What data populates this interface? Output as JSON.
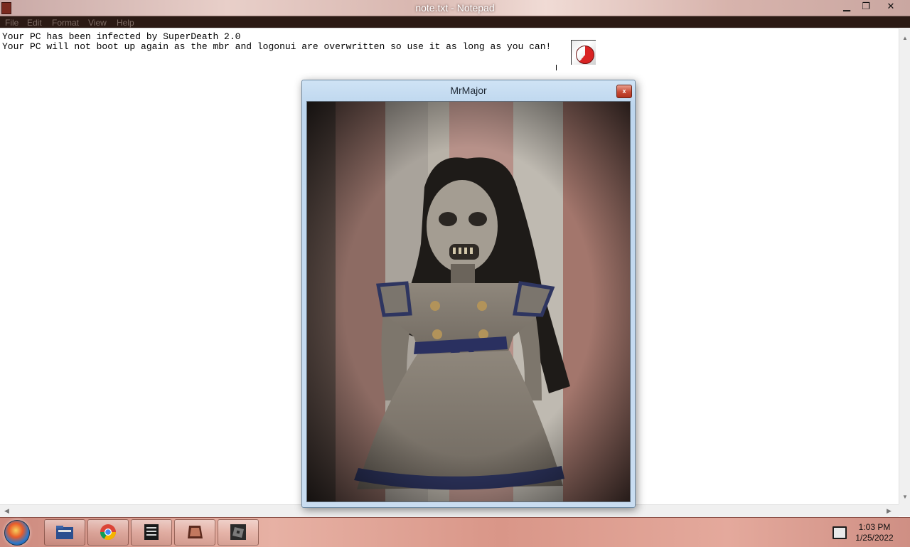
{
  "window": {
    "title": "note.txt - Notepad",
    "controls": {
      "minimize": "▁",
      "maximize": "❐",
      "close": "✕"
    }
  },
  "menu": [
    "File",
    "Edit",
    "Format",
    "View",
    "Help"
  ],
  "document": {
    "lines": [
      "Your PC has been infected by SuperDeath 2.0",
      "Your PC will not boot up again as the mbr and logonui are overwritten so use it as long as you can!"
    ]
  },
  "popup": {
    "title": "MrMajor",
    "close_label": "x"
  },
  "taskbar": {
    "pinned": [
      {
        "name": "taskbar-file-explorer",
        "icon": "folder-icon"
      },
      {
        "name": "taskbar-chrome",
        "icon": "chrome-icon"
      },
      {
        "name": "taskbar-notepad",
        "icon": "notepad-icon"
      },
      {
        "name": "taskbar-image",
        "icon": "image-icon"
      },
      {
        "name": "taskbar-roblox",
        "icon": "roblox-icon"
      }
    ],
    "clock": {
      "time": "1:03 PM",
      "date": "1/25/2022"
    }
  },
  "colors": {
    "popup_close": "#c74a34",
    "menu_bar": "#2b1a14",
    "taskbar_tint": "#e2a597"
  }
}
